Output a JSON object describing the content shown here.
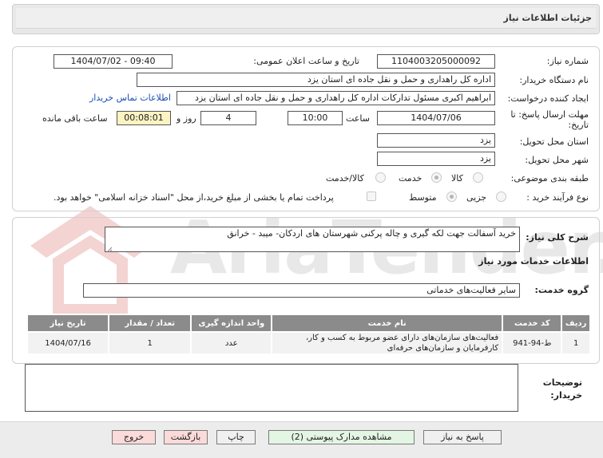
{
  "header": {
    "title": "جزئیات اطلاعات نیاز"
  },
  "need_number": {
    "label": "شماره نیاز:",
    "value": "1104003205000092"
  },
  "announce": {
    "label": "تاریخ و ساعت اعلان عمومی:",
    "value": "1404/07/02 - 09:40"
  },
  "buyer": {
    "label": "نام دستگاه خریدار:",
    "value": "اداره کل راهداری و حمل و نقل جاده ای استان یزد"
  },
  "creator": {
    "label": "ایجاد کننده درخواست:",
    "value": "ابراهیم اکبری مسئول تدارکات اداره کل راهداری و حمل و نقل جاده ای استان یزد",
    "contact_link": "اطلاعات تماس خریدار"
  },
  "deadline": {
    "label_line1": "مهلت ارسال پاسخ: تا",
    "label_line2": "تاریخ:",
    "date": "1404/07/06",
    "time_label": "ساعت",
    "time": "10:00",
    "days": "4",
    "days_label": "روز و",
    "remaining": "00:08:01",
    "remaining_label": "ساعت باقی مانده"
  },
  "province": {
    "label": "استان محل تحویل:",
    "value": "یزد"
  },
  "city": {
    "label": "شهر محل تحویل:",
    "value": "یزد"
  },
  "category": {
    "label": "طبقه بندی موضوعی:",
    "options": [
      "کالا",
      "خدمت",
      "کالا/خدمت"
    ],
    "selected": "خدمت"
  },
  "process": {
    "label": "نوع فرآیند خرید :",
    "options": [
      "جزیی",
      "متوسط"
    ],
    "selected": "متوسط",
    "payment_note": "پرداخت تمام یا بخشی از مبلغ خرید،از محل \"اسناد خزانه اسلامی\" خواهد بود."
  },
  "description": {
    "label": "شرح کلی نیاز:",
    "value": "خرید آسفالت جهت لکه گیری و چاله پرکنی شهرستان های اردکان- میبد - خرانق"
  },
  "services_heading": "اطلاعات خدمات مورد نیاز",
  "service_group": {
    "label": "گروه خدمت:",
    "value": "سایر فعالیت‌های خدماتی"
  },
  "table": {
    "headers": [
      "ردیف",
      "کد خدمت",
      "نام خدمت",
      "واحد اندازه گیری",
      "تعداد / مقدار",
      "تاریخ نیاز"
    ],
    "rows": [
      {
        "index": "1",
        "code": "ط-94-941",
        "name": "فعالیت‌های سازمان‌های دارای عضو مربوط به کسب و کار، کارفرمایان و سازمان‌های حرفه‌ای",
        "unit": "عدد",
        "qty": "1",
        "date": "1404/07/16"
      }
    ]
  },
  "buyer_notes": {
    "label_line1": "توضیحات",
    "label_line2": "خریدار:",
    "value": ""
  },
  "buttons": {
    "reply": "پاسخ به نیاز",
    "attachments": "مشاهده مدارک پیوستی (2)",
    "print": "چاپ",
    "back": "بازگشت",
    "exit": "خروج"
  },
  "watermark": {
    "text": "AriaTender.net"
  }
}
